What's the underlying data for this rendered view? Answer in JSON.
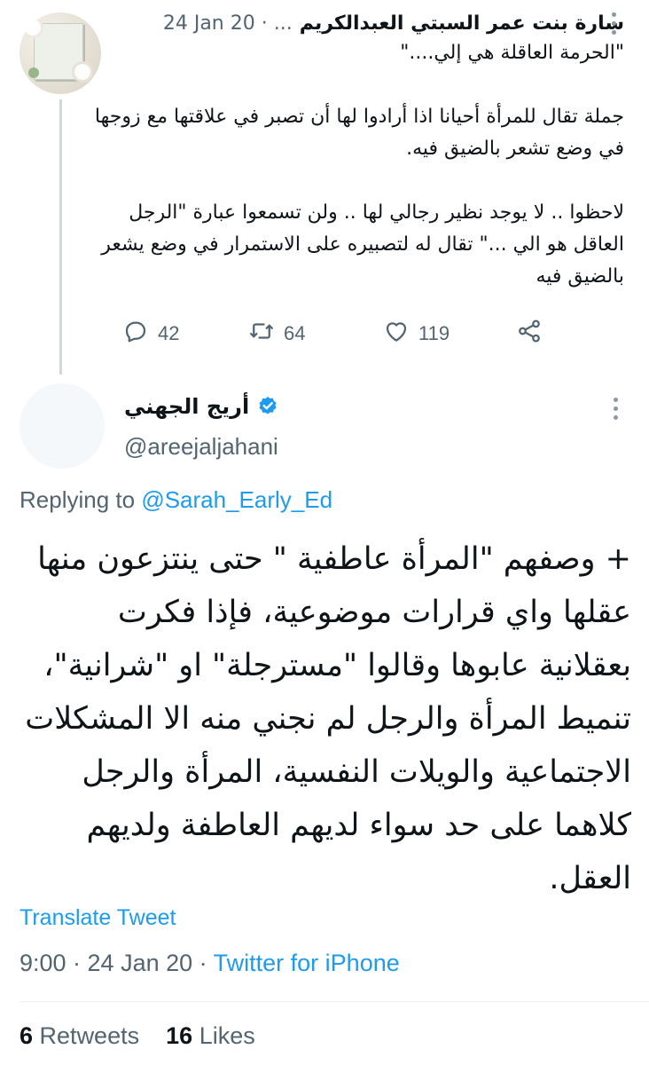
{
  "parent_tweet": {
    "author_name": "سارة بنت عمر السبتي العبدالكريم",
    "meta": "24 Jan 20 · ...",
    "text": "\"الحرمة العاقلة هي إلي....\"\n\nجملة تقال للمرأة أحيانا اذا أرادوا لها أن تصبر في علاقتها مع زوجها في وضع تشعر بالضيق فيه.\n\nلاحظوا .. لا يوجد نظير رجالي لها .. ولن تسمعوا عبارة \"الرجل العاقل هو الي ...\" تقال له لتصبيره على الاستمرار في وضع يشعر بالضيق فيه",
    "actions": {
      "replies": "42",
      "retweets": "64",
      "likes": "119"
    }
  },
  "main_tweet": {
    "author_name": "أريج الجهني",
    "handle": "@areejaljahani",
    "replying_prefix": "Replying to",
    "replying_to": "@Sarah_Early_Ed",
    "text": "+ وصفهم \"المرأة عاطفية \" حتى ينتزعون منها عقلها واي قرارات موضوعية، فإذا فكرت بعقلانية عابوها وقالوا \"مسترجلة\" او \"شرانية\"، تنميط المرأة والرجل لم نجني منه الا المشكلات الاجتماعية والويلات النفسية، المرأة والرجل كلاهما على حد سواء لديهم العاطفة ولديهم العقل.",
    "translate": "Translate Tweet",
    "time": "9:00 · 24 Jan 20 · ",
    "source": "Twitter for iPhone",
    "retweets_count": "6",
    "retweets_label": "Retweets",
    "likes_count": "16",
    "likes_label": "Likes"
  },
  "colors": {
    "accent": "#1d9bf0",
    "secondary_text": "#536471",
    "primary_text": "#0f1419",
    "thread_line": "#cfd9de"
  },
  "icons": [
    "reply-icon",
    "retweet-icon",
    "like-icon",
    "share-icon",
    "verified-icon",
    "more-icon"
  ]
}
